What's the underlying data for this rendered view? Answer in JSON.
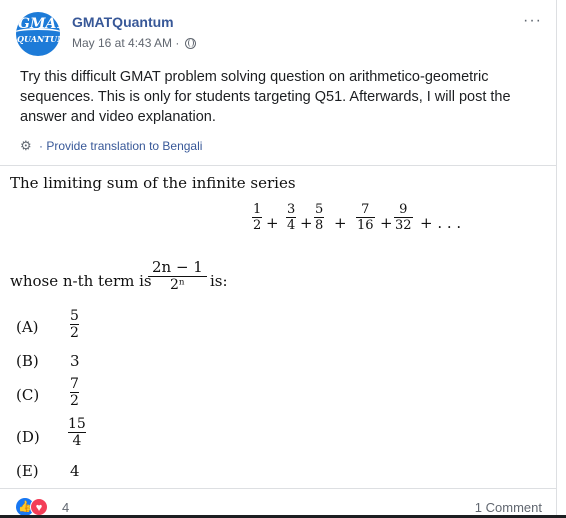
{
  "post": {
    "page_name": "GMATQuantum",
    "avatar_text_top": "GMAT",
    "avatar_text_bottom": "QUANTUM",
    "timestamp": "May 16 at 4:43 AM",
    "separator": "·",
    "more_label": "···",
    "text": "Try this difficult GMAT problem solving question on arithmetico-geometric sequences. This is only for students targeting Q51. Afterwards, I will post the answer and video explanation.",
    "translate_label": "Provide translation to Bengali",
    "translate_dot": "·"
  },
  "question": {
    "line1": "The limiting sum of the infinite series",
    "series": [
      {
        "num": "1",
        "den": "2"
      },
      {
        "num": "3",
        "den": "4"
      },
      {
        "num": "5",
        "den": "8"
      },
      {
        "num": "7",
        "den": "16"
      },
      {
        "num": "9",
        "den": "32"
      }
    ],
    "plus": "+",
    "ellipsis": "+ . . .",
    "whose": "whose n-th term is",
    "term_num": "2n − 1",
    "term_den": "2ⁿ",
    "is": "is:",
    "options": [
      {
        "label": "(A)",
        "num": "5",
        "den": "2",
        "plain": ""
      },
      {
        "label": "(B)",
        "num": "",
        "den": "",
        "plain": "3"
      },
      {
        "label": "(C)",
        "num": "7",
        "den": "2",
        "plain": ""
      },
      {
        "label": "(D)",
        "num": "15",
        "den": "4",
        "plain": ""
      },
      {
        "label": "(E)",
        "num": "",
        "den": "",
        "plain": "4"
      }
    ]
  },
  "footer": {
    "reaction_count": "4",
    "comments": "1 Comment"
  },
  "colors": {
    "link": "#385898",
    "meta": "#616770",
    "like": "#1877f2",
    "love": "#f33e58"
  }
}
